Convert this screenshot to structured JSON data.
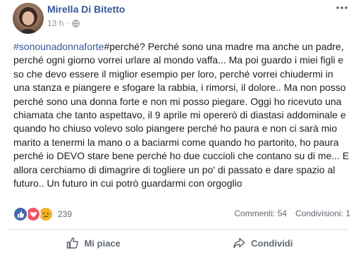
{
  "post": {
    "author": "Mirella Di Bitetto",
    "time": "13 h",
    "privacy_icon": "globe-icon",
    "more_icon": "more-options-icon",
    "hashtag": "#sonounadonnaforte",
    "body": "#perché? Perché sono una madre ma anche un padre, perché ogni giorno vorrei urlare al mondo vaffa... Ma poi guardo i miei figli e so che devo essere il miglior esempio per loro, perché vorrei chiudermi in una stanza e piangere e sfogare la rabbia, i rimorsi, il dolore.. Ma non posso perché sono una donna forte e non mi posso piegare. Oggi ho ricevuto una chiamata che tanto aspettavo, il 9 aprile mi opererò di diastasi addominale e quando ho chiuso volevo solo piangere perché ho paura e non ci sarà mio marito a tenermi la mano o a baciarmi come quando ho partorito, ho paura perché io DEVO stare bene perché ho due cuccioli che contano su di me... E allora cerchiamo di dimagrire di togliere un po' di passato e dare spazio al futuro.. Un futuro in cui potrò guardarmi con orgoglio"
  },
  "reactions": {
    "types": [
      "like-icon",
      "love-icon",
      "sad-icon"
    ],
    "count": "239",
    "colors": {
      "like": "#4267b2",
      "love": "#f25268",
      "sad": "#f7b125"
    }
  },
  "stats": {
    "comments": "Commenti: 54",
    "shares": "Condivisioni: 1"
  },
  "actions": {
    "like_label": "Mi piace",
    "share_label": "Condividi"
  },
  "colors": {
    "link": "#385898",
    "text": "#1c1e21",
    "muted": "#606770"
  }
}
